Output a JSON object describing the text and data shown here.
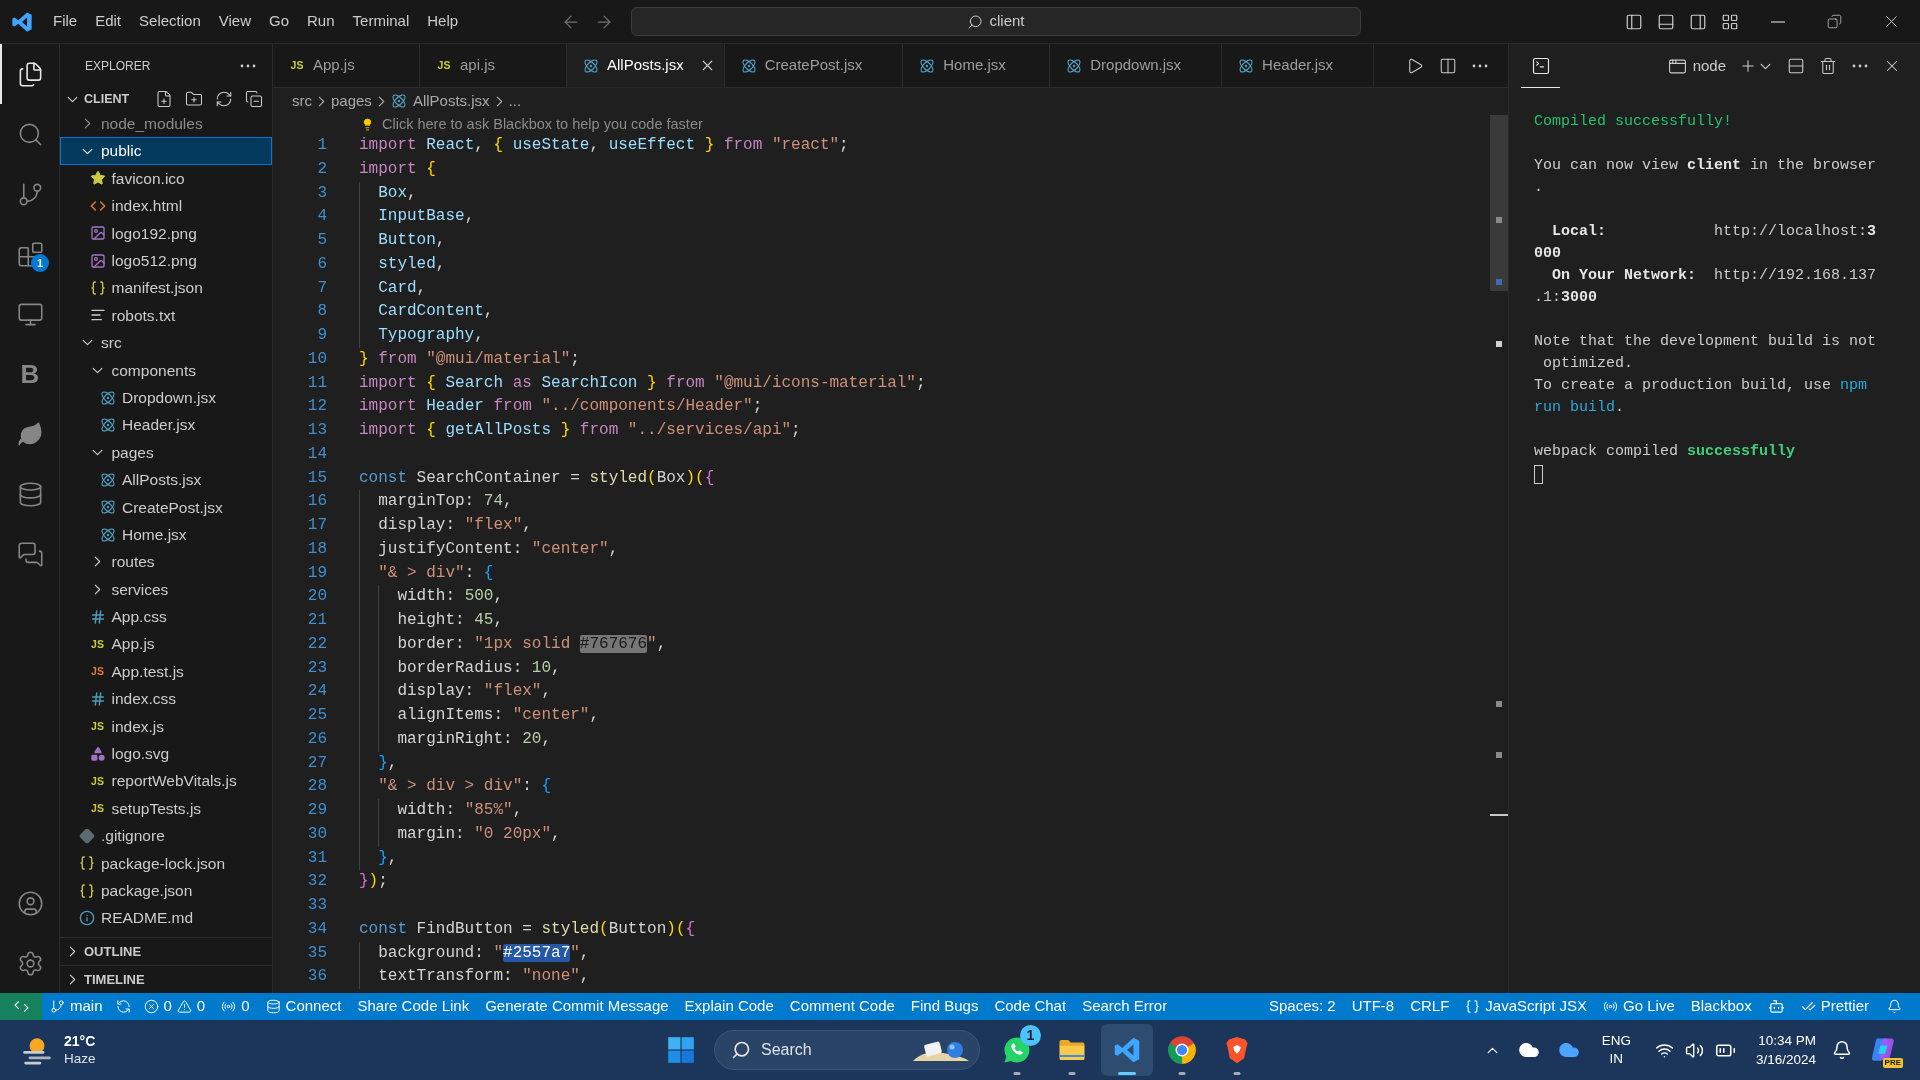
{
  "title_bar": {
    "menu": [
      "File",
      "Edit",
      "Selection",
      "View",
      "Go",
      "Run",
      "Terminal",
      "Help"
    ],
    "command_center": "client"
  },
  "activity_bar": {
    "items": [
      {
        "kind": "explorer",
        "selected": true
      },
      {
        "kind": "search",
        "selected": false
      },
      {
        "kind": "source-control",
        "selected": false
      },
      {
        "kind": "extensions",
        "selected": false,
        "badge": "1"
      },
      {
        "kind": "remote",
        "selected": false
      },
      {
        "kind": "letter",
        "selected": false,
        "glyph": "B"
      },
      {
        "kind": "leaf",
        "selected": false
      },
      {
        "kind": "database",
        "selected": false
      },
      {
        "kind": "chat",
        "selected": false
      }
    ],
    "bottom": [
      {
        "kind": "account"
      },
      {
        "kind": "settings"
      }
    ]
  },
  "sidebar": {
    "title": "EXPLORER",
    "section": {
      "title": "CLIENT",
      "expanded": true
    },
    "tree": [
      {
        "name": "node_modules",
        "kind": "folder",
        "expanded": false,
        "selected": false,
        "ignored": true
      },
      {
        "name": "public",
        "kind": "folder",
        "expanded": true,
        "selected": true,
        "ignored": false,
        "children": [
          {
            "name": "favicon.ico",
            "kind": "star",
            "selected": false,
            "ignored": false
          },
          {
            "name": "index.html",
            "kind": "html",
            "selected": false,
            "ignored": false
          },
          {
            "name": "logo192.png",
            "kind": "image",
            "selected": false,
            "ignored": false
          },
          {
            "name": "logo512.png",
            "kind": "image",
            "selected": false,
            "ignored": false
          },
          {
            "name": "manifest.json",
            "kind": "json",
            "selected": false,
            "ignored": false
          },
          {
            "name": "robots.txt",
            "kind": "text",
            "selected": false,
            "ignored": false
          }
        ]
      },
      {
        "name": "src",
        "kind": "folder",
        "expanded": true,
        "selected": false,
        "ignored": false,
        "children": [
          {
            "name": "components",
            "kind": "folder",
            "expanded": true,
            "selected": false,
            "ignored": false,
            "children": [
              {
                "name": "Dropdown.jsx",
                "kind": "react",
                "selected": false,
                "ignored": false
              },
              {
                "name": "Header.jsx",
                "kind": "react",
                "selected": false,
                "ignored": false
              }
            ]
          },
          {
            "name": "pages",
            "kind": "folder",
            "expanded": true,
            "selected": false,
            "ignored": false,
            "children": [
              {
                "name": "AllPosts.jsx",
                "kind": "react",
                "selected": false,
                "ignored": false
              },
              {
                "name": "CreatePost.jsx",
                "kind": "react",
                "selected": false,
                "ignored": false
              },
              {
                "name": "Home.jsx",
                "kind": "react",
                "selected": false,
                "ignored": false
              }
            ]
          },
          {
            "name": "routes",
            "kind": "folder",
            "expanded": false,
            "selected": false,
            "ignored": false
          },
          {
            "name": "services",
            "kind": "folder",
            "expanded": false,
            "selected": false,
            "ignored": false
          },
          {
            "name": "App.css",
            "kind": "css",
            "selected": false,
            "ignored": false
          },
          {
            "name": "App.js",
            "kind": "js",
            "glyph": "JS",
            "selected": false,
            "ignored": false
          },
          {
            "name": "App.test.js",
            "kind": "test",
            "glyph": "JS",
            "selected": false,
            "ignored": false
          },
          {
            "name": "index.css",
            "kind": "css",
            "selected": false,
            "ignored": false
          },
          {
            "name": "index.js",
            "kind": "js",
            "glyph": "JS",
            "selected": false,
            "ignored": false
          },
          {
            "name": "logo.svg",
            "kind": "svg",
            "selected": false,
            "ignored": false
          },
          {
            "name": "reportWebVitals.js",
            "kind": "js",
            "glyph": "JS",
            "selected": false,
            "ignored": false
          },
          {
            "name": "setupTests.js",
            "kind": "js",
            "glyph": "JS",
            "selected": false,
            "ignored": false
          }
        ]
      },
      {
        "name": ".gitignore",
        "kind": "git",
        "selected": false,
        "ignored": false
      },
      {
        "name": "package-lock.json",
        "kind": "json",
        "selected": false,
        "ignored": false
      },
      {
        "name": "package.json",
        "kind": "json",
        "selected": false,
        "ignored": false
      },
      {
        "name": "README.md",
        "kind": "info",
        "selected": false,
        "ignored": false
      }
    ],
    "panels": [
      {
        "title": "OUTLINE",
        "expanded": false
      },
      {
        "title": "TIMELINE",
        "expanded": false
      }
    ]
  },
  "editor": {
    "tabs": [
      {
        "label": "App.js",
        "kind": "js",
        "glyph": "JS",
        "selected": false
      },
      {
        "label": "api.js",
        "kind": "js",
        "glyph": "JS",
        "selected": false
      },
      {
        "label": "AllPosts.jsx",
        "kind": "react",
        "selected": true
      },
      {
        "label": "CreatePost.jsx",
        "kind": "react",
        "selected": false
      },
      {
        "label": "Home.jsx",
        "kind": "react",
        "selected": false
      },
      {
        "label": "Dropdown.jsx",
        "kind": "react",
        "selected": false
      },
      {
        "label": "Header.jsx",
        "kind": "react",
        "selected": false
      }
    ],
    "breadcrumb": [
      {
        "label": "src",
        "kind": "folder"
      },
      {
        "label": "pages",
        "kind": "folder"
      },
      {
        "label": "AllPosts.jsx",
        "kind": "react"
      },
      {
        "label": "...",
        "kind": "symbol"
      }
    ],
    "hint": "Click here to ask Blackbox to help you code faster",
    "lines": [
      {
        "number": "1",
        "tokens": [
          {
            "text": "import ",
            "kind": "keyword"
          },
          {
            "text": "React",
            "kind": "variable"
          },
          {
            "text": ", ",
            "kind": "plain"
          },
          {
            "text": "{ ",
            "kind": "bracket1"
          },
          {
            "text": "useState",
            "kind": "variable"
          },
          {
            "text": ", ",
            "kind": "plain"
          },
          {
            "text": "useEffect ",
            "kind": "variable"
          },
          {
            "text": "} ",
            "kind": "bracket1"
          },
          {
            "text": "from ",
            "kind": "keyword"
          },
          {
            "text": "\"react\"",
            "kind": "string"
          },
          {
            "text": ";",
            "kind": "plain"
          }
        ]
      },
      {
        "number": "2",
        "tokens": [
          {
            "text": "import ",
            "kind": "keyword"
          },
          {
            "text": "{",
            "kind": "bracket1"
          }
        ]
      },
      {
        "number": "3",
        "tokens": [
          {
            "text": "  Box",
            "kind": "variable"
          },
          {
            "text": ",",
            "kind": "plain"
          }
        ]
      },
      {
        "number": "4",
        "tokens": [
          {
            "text": "  InputBase",
            "kind": "variable"
          },
          {
            "text": ",",
            "kind": "plain"
          }
        ]
      },
      {
        "number": "5",
        "tokens": [
          {
            "text": "  Button",
            "kind": "variable"
          },
          {
            "text": ",",
            "kind": "plain"
          }
        ]
      },
      {
        "number": "6",
        "tokens": [
          {
            "text": "  styled",
            "kind": "variable"
          },
          {
            "text": ",",
            "kind": "plain"
          }
        ]
      },
      {
        "number": "7",
        "tokens": [
          {
            "text": "  Card",
            "kind": "variable"
          },
          {
            "text": ",",
            "kind": "plain"
          }
        ]
      },
      {
        "number": "8",
        "tokens": [
          {
            "text": "  CardContent",
            "kind": "variable"
          },
          {
            "text": ",",
            "kind": "plain"
          }
        ]
      },
      {
        "number": "9",
        "tokens": [
          {
            "text": "  Typography",
            "kind": "variable"
          },
          {
            "text": ",",
            "kind": "plain"
          }
        ]
      },
      {
        "number": "10",
        "tokens": [
          {
            "text": "} ",
            "kind": "bracket1"
          },
          {
            "text": "from ",
            "kind": "keyword"
          },
          {
            "text": "\"@mui/material\"",
            "kind": "string"
          },
          {
            "text": ";",
            "kind": "plain"
          }
        ]
      },
      {
        "number": "11",
        "tokens": [
          {
            "text": "import ",
            "kind": "keyword"
          },
          {
            "text": "{ ",
            "kind": "bracket1"
          },
          {
            "text": "Search ",
            "kind": "variable"
          },
          {
            "text": "as ",
            "kind": "keyword"
          },
          {
            "text": "SearchIcon ",
            "kind": "variable"
          },
          {
            "text": "} ",
            "kind": "bracket1"
          },
          {
            "text": "from ",
            "kind": "keyword"
          },
          {
            "text": "\"@mui/icons-material\"",
            "kind": "string"
          },
          {
            "text": ";",
            "kind": "plain"
          }
        ]
      },
      {
        "number": "12",
        "tokens": [
          {
            "text": "import ",
            "kind": "keyword"
          },
          {
            "text": "Header ",
            "kind": "variable"
          },
          {
            "text": "from ",
            "kind": "keyword"
          },
          {
            "text": "\"../components/Header\"",
            "kind": "string"
          },
          {
            "text": ";",
            "kind": "plain"
          }
        ]
      },
      {
        "number": "13",
        "tokens": [
          {
            "text": "import ",
            "kind": "keyword"
          },
          {
            "text": "{ ",
            "kind": "bracket1"
          },
          {
            "text": "getAllPosts ",
            "kind": "variable"
          },
          {
            "text": "} ",
            "kind": "bracket1"
          },
          {
            "text": "from ",
            "kind": "keyword"
          },
          {
            "text": "\"../services/api\"",
            "kind": "string"
          },
          {
            "text": ";",
            "kind": "plain"
          }
        ]
      },
      {
        "number": "14"
      },
      {
        "number": "15",
        "tokens": [
          {
            "text": "const ",
            "kind": "storage"
          },
          {
            "text": "SearchContainer = ",
            "kind": "plain"
          },
          {
            "text": "styled",
            "kind": "function"
          },
          {
            "text": "(",
            "kind": "bracket1"
          },
          {
            "text": "Box",
            "kind": "plain"
          },
          {
            "text": ")",
            "kind": "bracket1"
          },
          {
            "text": "(",
            "kind": "bracket1"
          },
          {
            "text": "{",
            "kind": "bracket2"
          }
        ]
      },
      {
        "number": "16",
        "tokens": [
          {
            "text": "  marginTop: ",
            "kind": "plain"
          },
          {
            "text": "74",
            "kind": "number"
          },
          {
            "text": ",",
            "kind": "plain"
          }
        ]
      },
      {
        "number": "17",
        "tokens": [
          {
            "text": "  display: ",
            "kind": "plain"
          },
          {
            "text": "\"flex\"",
            "kind": "string"
          },
          {
            "text": ",",
            "kind": "plain"
          }
        ]
      },
      {
        "number": "18",
        "tokens": [
          {
            "text": "  justifyContent: ",
            "kind": "plain"
          },
          {
            "text": "\"center\"",
            "kind": "string"
          },
          {
            "text": ",",
            "kind": "plain"
          }
        ]
      },
      {
        "number": "19",
        "tokens": [
          {
            "text": "  \"& > div\"",
            "kind": "string"
          },
          {
            "text": ": ",
            "kind": "plain"
          },
          {
            "text": "{",
            "kind": "bracket3"
          }
        ]
      },
      {
        "number": "20",
        "tokens": [
          {
            "text": "    width: ",
            "kind": "plain"
          },
          {
            "text": "500",
            "kind": "number"
          },
          {
            "text": ",",
            "kind": "plain"
          }
        ]
      },
      {
        "number": "21",
        "tokens": [
          {
            "text": "    height: ",
            "kind": "plain"
          },
          {
            "text": "45",
            "kind": "number"
          },
          {
            "text": ",",
            "kind": "plain"
          }
        ]
      },
      {
        "number": "22",
        "tokens": [
          {
            "text": "    border: ",
            "kind": "plain"
          },
          {
            "text": "\"1px solid ",
            "kind": "string"
          },
          {
            "text": "#767676",
            "kind": "string",
            "color": "#767676"
          },
          {
            "text": "\"",
            "kind": "string"
          },
          {
            "text": ",",
            "kind": "plain"
          }
        ]
      },
      {
        "number": "23",
        "tokens": [
          {
            "text": "    borderRadius: ",
            "kind": "plain"
          },
          {
            "text": "10",
            "kind": "number"
          },
          {
            "text": ",",
            "kind": "plain"
          }
        ]
      },
      {
        "number": "24",
        "tokens": [
          {
            "text": "    display: ",
            "kind": "plain"
          },
          {
            "text": "\"flex\"",
            "kind": "string"
          },
          {
            "text": ",",
            "kind": "plain"
          }
        ]
      },
      {
        "number": "25",
        "tokens": [
          {
            "text": "    alignItems: ",
            "kind": "plain"
          },
          {
            "text": "\"center\"",
            "kind": "string"
          },
          {
            "text": ",",
            "kind": "plain"
          }
        ]
      },
      {
        "number": "26",
        "tokens": [
          {
            "text": "    marginRight: ",
            "kind": "plain"
          },
          {
            "text": "20",
            "kind": "number"
          },
          {
            "text": ",",
            "kind": "plain"
          }
        ]
      },
      {
        "number": "27",
        "tokens": [
          {
            "text": "  }",
            "kind": "bracket3"
          },
          {
            "text": ",",
            "kind": "plain"
          }
        ]
      },
      {
        "number": "28",
        "tokens": [
          {
            "text": "  \"& > div > div\"",
            "kind": "string"
          },
          {
            "text": ": ",
            "kind": "plain"
          },
          {
            "text": "{",
            "kind": "bracket3"
          }
        ]
      },
      {
        "number": "29",
        "tokens": [
          {
            "text": "    width: ",
            "kind": "plain"
          },
          {
            "text": "\"85%\"",
            "kind": "string"
          },
          {
            "text": ",",
            "kind": "plain"
          }
        ]
      },
      {
        "number": "30",
        "tokens": [
          {
            "text": "    margin: ",
            "kind": "plain"
          },
          {
            "text": "\"0 20px\"",
            "kind": "string"
          },
          {
            "text": ",",
            "kind": "plain"
          }
        ]
      },
      {
        "number": "31",
        "tokens": [
          {
            "text": "  }",
            "kind": "bracket3"
          },
          {
            "text": ",",
            "kind": "plain"
          }
        ]
      },
      {
        "number": "32",
        "tokens": [
          {
            "text": "}",
            "kind": "bracket2"
          },
          {
            "text": ")",
            "kind": "bracket1"
          },
          {
            "text": ";",
            "kind": "plain"
          }
        ]
      },
      {
        "number": "33"
      },
      {
        "number": "34",
        "tokens": [
          {
            "text": "const ",
            "kind": "storage"
          },
          {
            "text": "FindButton = ",
            "kind": "plain"
          },
          {
            "text": "styled",
            "kind": "function"
          },
          {
            "text": "(",
            "kind": "bracket1"
          },
          {
            "text": "Button",
            "kind": "plain"
          },
          {
            "text": ")",
            "kind": "bracket1"
          },
          {
            "text": "(",
            "kind": "bracket1"
          },
          {
            "text": "{",
            "kind": "bracket2"
          }
        ]
      },
      {
        "number": "35",
        "tokens": [
          {
            "text": "  background: ",
            "kind": "plain"
          },
          {
            "text": "\"",
            "kind": "string"
          },
          {
            "text": "#2557a7",
            "kind": "string",
            "color": "#2557a7"
          },
          {
            "text": "\"",
            "kind": "string"
          },
          {
            "text": ",",
            "kind": "plain"
          }
        ]
      },
      {
        "number": "36",
        "tokens": [
          {
            "text": "  textTransform: ",
            "kind": "plain"
          },
          {
            "text": "\"none\"",
            "kind": "string"
          },
          {
            "text": ",",
            "kind": "plain"
          }
        ]
      }
    ]
  },
  "terminal": {
    "profile": "node",
    "output": [
      {
        "lines": [
          {
            "segments": [
              {
                "text": "Compiled successfully!",
                "kind": "success"
              }
            ]
          }
        ]
      },
      {
        "lines": [
          {
            "segments": [
              {
                "text": "You can now view ",
                "kind": "plain"
              },
              {
                "text": "client",
                "kind": "bold"
              },
              {
                "text": " in the browser",
                "kind": "plain"
              }
            ]
          },
          {
            "segments": [
              {
                "text": ".",
                "kind": "plain"
              }
            ]
          }
        ]
      },
      {
        "lines": [
          {
            "segments": [
              {
                "text": "  Local:",
                "kind": "bold"
              },
              {
                "text": "            http://localhost:",
                "kind": "plain"
              },
              {
                "text": "3",
                "kind": "bold"
              }
            ]
          },
          {
            "segments": [
              {
                "text": "000",
                "kind": "bold"
              }
            ]
          },
          {
            "segments": [
              {
                "text": "  On Your Network:",
                "kind": "bold"
              },
              {
                "text": "  http://192.168.137",
                "kind": "plain"
              }
            ]
          },
          {
            "segments": [
              {
                "text": ".1:",
                "kind": "plain"
              },
              {
                "text": "3000",
                "kind": "bold"
              }
            ]
          }
        ]
      },
      {
        "lines": [
          {
            "segments": [
              {
                "text": "Note that the development build is not",
                "kind": "plain"
              }
            ]
          },
          {
            "segments": [
              {
                "text": " optimized.",
                "kind": "plain"
              }
            ]
          },
          {
            "segments": [
              {
                "text": "To create a production build, use ",
                "kind": "plain"
              },
              {
                "text": "npm",
                "kind": "command"
              }
            ]
          },
          {
            "segments": [
              {
                "text": "run build",
                "kind": "command"
              },
              {
                "text": ".",
                "kind": "plain"
              }
            ]
          }
        ]
      },
      {
        "lines": [
          {
            "segments": [
              {
                "text": "webpack compiled ",
                "kind": "plain"
              },
              {
                "text": "successfully",
                "kind": "success-bold"
              }
            ]
          }
        ]
      }
    ]
  },
  "status_bar": {
    "left": [
      {
        "kind": "remote"
      },
      {
        "kind": "branch",
        "label": "main"
      },
      {
        "kind": "sync"
      },
      {
        "kind": "problems",
        "errors": "0",
        "warnings": "0"
      },
      {
        "kind": "ports",
        "label": "0"
      },
      {
        "kind": "database",
        "label": "Connect"
      },
      {
        "kind": "text",
        "label": "Share Code Link"
      },
      {
        "kind": "text",
        "label": "Generate Commit Message"
      },
      {
        "kind": "text",
        "label": "Explain Code"
      },
      {
        "kind": "text",
        "label": "Comment Code"
      },
      {
        "kind": "text",
        "label": "Find Bugs"
      },
      {
        "kind": "text",
        "label": "Code Chat"
      },
      {
        "kind": "text",
        "label": "Search Error"
      }
    ],
    "right": [
      {
        "kind": "text",
        "label": "Spaces: 2"
      },
      {
        "kind": "text",
        "label": "UTF-8"
      },
      {
        "kind": "text",
        "label": "CRLF"
      },
      {
        "kind": "language",
        "label": "JavaScript JSX"
      },
      {
        "kind": "live",
        "label": "Go Live"
      },
      {
        "kind": "text",
        "label": "Blackbox"
      },
      {
        "kind": "robot"
      },
      {
        "kind": "prettier",
        "label": "Prettier"
      },
      {
        "kind": "bell"
      }
    ]
  },
  "taskbar": {
    "weather": {
      "temperature": "21°C",
      "condition": "Haze"
    },
    "search": {
      "placeholder": "Search"
    },
    "apps": [
      {
        "kind": "start",
        "running": false,
        "selected": false
      },
      {
        "kind": "chat",
        "badge": "1",
        "running": true,
        "selected": false
      },
      {
        "kind": "folder",
        "running": true,
        "selected": false
      },
      {
        "kind": "code",
        "running": true,
        "selected": true
      },
      {
        "kind": "browser",
        "running": true,
        "selected": false
      },
      {
        "kind": "shield",
        "running": true,
        "selected": false
      }
    ],
    "tray": {
      "language": "ENG",
      "region": "IN",
      "time": "10:34 PM",
      "date": "3/16/2024",
      "preview_label": "PRE"
    }
  }
}
